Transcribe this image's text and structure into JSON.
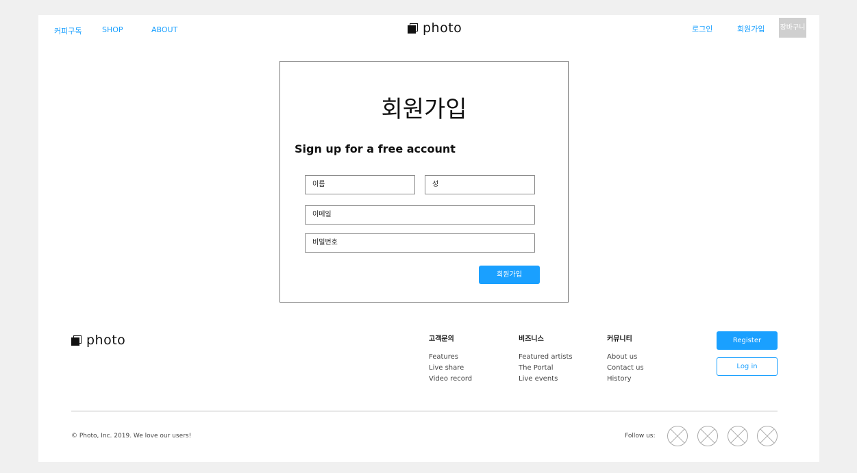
{
  "header": {
    "nav": [
      "커피구독",
      "SHOP",
      "ABOUT"
    ],
    "logo_text": "photo",
    "login": "로그인",
    "signup": "회원가입",
    "cart": "장바구니"
  },
  "signup_card": {
    "title": "회원가입",
    "subtitle": "Sign up for a free account",
    "first_name_placeholder": "이름",
    "last_name_placeholder": "성",
    "email_placeholder": "이메일",
    "password_placeholder": "비밀번호",
    "submit_label": "회원가입"
  },
  "footer": {
    "logo_text": "photo",
    "columns": [
      {
        "heading": "고객문의",
        "items": [
          "Features",
          "Live share",
          "Video record"
        ]
      },
      {
        "heading": "비즈니스",
        "items": [
          "Featured artists",
          "The Portal",
          "Live events"
        ]
      },
      {
        "heading": "커뮤니티",
        "items": [
          "About us",
          "Contact us",
          "History"
        ]
      }
    ],
    "register_label": "Register",
    "login_label": "Log in",
    "copyright": "© Photo, Inc. 2019. We love our users!",
    "follow_label": "Follow us:",
    "social_icons": [
      "social-placeholder-icon",
      "social-placeholder-icon",
      "social-placeholder-icon",
      "social-placeholder-icon"
    ]
  },
  "colors": {
    "accent": "#1aa0ff",
    "page_bg": "#f0f0f0",
    "cart_bg": "#cfcfcf"
  }
}
